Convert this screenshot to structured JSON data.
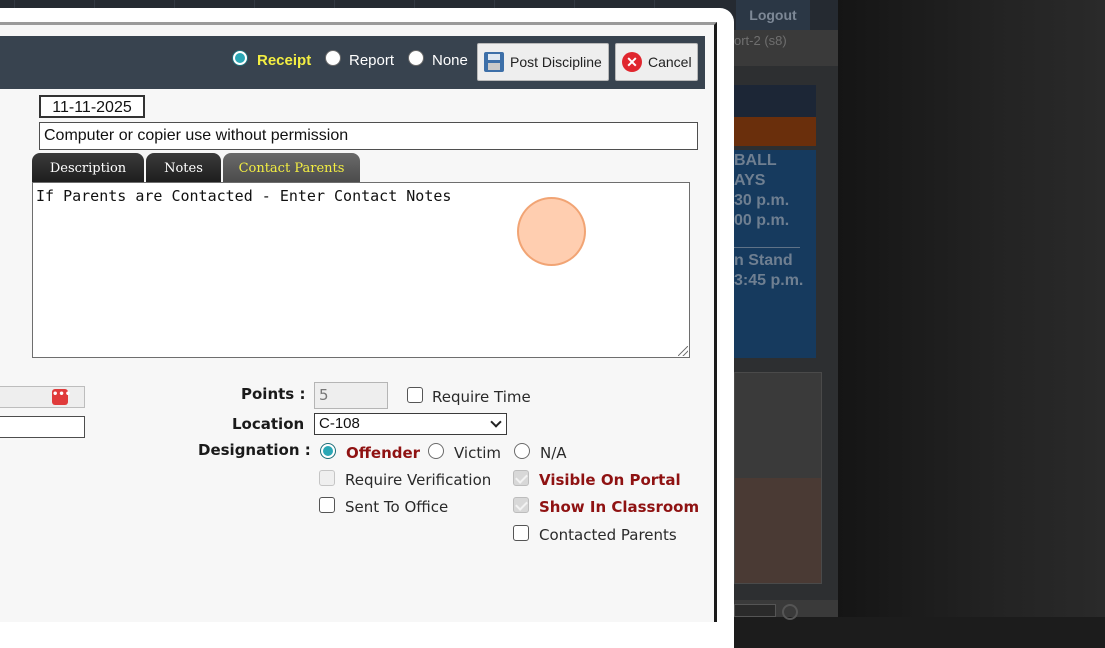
{
  "background": {
    "logout_label": "Logout",
    "sport_label": "ort-2 (s8)",
    "notice_lines": [
      "BALL",
      "AYS",
      "30 p.m.",
      "00 p.m.",
      "n Stand",
      "3:45 p.m."
    ]
  },
  "header": {
    "options": [
      {
        "label": "Receipt",
        "selected": true
      },
      {
        "label": "Report",
        "selected": false
      },
      {
        "label": "None",
        "selected": false
      }
    ],
    "post_button": "Post Discipline",
    "cancel_button": "Cancel",
    "cancel_icon_glyph": "✕"
  },
  "form": {
    "date": "11-11-2025",
    "incident": "Computer or copier use without permission",
    "tabs": [
      "Description",
      "Notes",
      "Contact Parents"
    ],
    "active_tab": "Contact Parents",
    "notes_text": "If Parents are Contacted - Enter Contact Notes",
    "points_label": "Points :",
    "points_value": "5",
    "require_time_label": "Require Time",
    "location_label": "Location",
    "location_value": "C-108",
    "designation_label": "Designation :",
    "designation_options": [
      {
        "label": "Offender",
        "selected": true
      },
      {
        "label": "Victim",
        "selected": false
      },
      {
        "label": "N/A",
        "selected": false
      }
    ],
    "checkboxes": {
      "require_verification": "Require Verification",
      "sent_to_office": "Sent To Office",
      "visible_on_portal": "Visible On Portal",
      "show_in_classroom": "Show In Classroom",
      "contacted_parents": "Contacted Parents"
    }
  },
  "colors": {
    "header_bg": "#38434f",
    "active_accent": "#f3ee42",
    "emphasis_red": "#8f1212",
    "radio_teal": "#2aa7b5"
  }
}
